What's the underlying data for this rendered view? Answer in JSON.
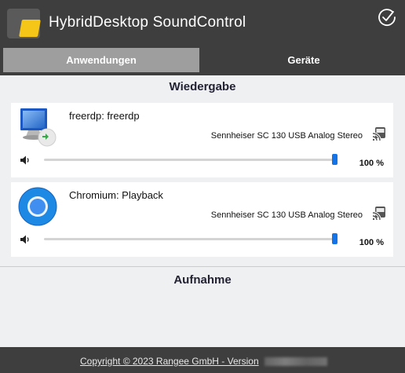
{
  "app": {
    "title": "HybridDesktop SoundControl"
  },
  "tabs": [
    {
      "label": "Anwendungen",
      "active": true
    },
    {
      "label": "Geräte",
      "active": false
    }
  ],
  "sections": {
    "playback": "Wiedergabe",
    "recording": "Aufnahme"
  },
  "playback_items": [
    {
      "app_name": "freerdp: freerdp",
      "icon": "remote-desktop-icon",
      "device": "Sennheiser SC 130 USB Analog Stereo",
      "volume_pct": 100,
      "volume_label": "100 %"
    },
    {
      "app_name": "Chromium: Playback",
      "icon": "chromium-icon",
      "device": "Sennheiser SC 130 USB Analog Stereo",
      "volume_pct": 100,
      "volume_label": "100 %"
    }
  ],
  "footer": {
    "copyright": "Copyright © 2023 Rangee GmbH - Version"
  },
  "colors": {
    "header_bg": "#3e3e3e",
    "active_tab": "#9e9e9e",
    "accent": "#1473e6",
    "logo_yellow": "#f5c518"
  }
}
